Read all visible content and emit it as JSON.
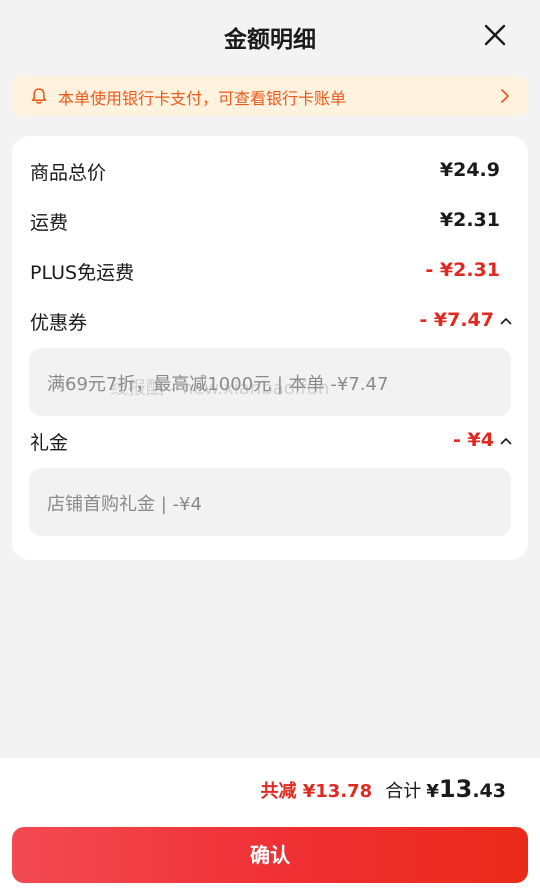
{
  "header": {
    "title": "金额明细"
  },
  "notice": {
    "text": "本单使用银行卡支付，可查看银行卡账单"
  },
  "rows": {
    "goods_total": {
      "label": "商品总价",
      "value": "¥24.9"
    },
    "shipping": {
      "label": "运费",
      "value": "¥2.31"
    },
    "plus_free_shipping": {
      "label": "PLUS免运费",
      "value": "- ¥2.31"
    },
    "coupon": {
      "label": "优惠券",
      "value": "- ¥7.47",
      "detail": "满69元7折，最高减1000元 | 本单 -¥7.47"
    },
    "gift": {
      "label": "礼金",
      "value": "- ¥4",
      "detail": "店铺首购礼金 | -¥4"
    }
  },
  "watermark": "线报酷 - new.xianbao.fun",
  "footer": {
    "saved": "共减 ¥13.78",
    "sum_label": "合计",
    "sum_currency": "¥",
    "sum_integer": "13",
    "sum_decimal": ".43",
    "confirm_label": "确认"
  },
  "colors": {
    "accent_red": "#e02a1f",
    "notice_text": "#ee5a1c",
    "notice_bg": "#fff3e0"
  },
  "icons": {
    "close": "close-icon",
    "notice": "bell-icon",
    "notice_arrow": "chevron-right-icon",
    "expand": "chevron-up-icon"
  }
}
